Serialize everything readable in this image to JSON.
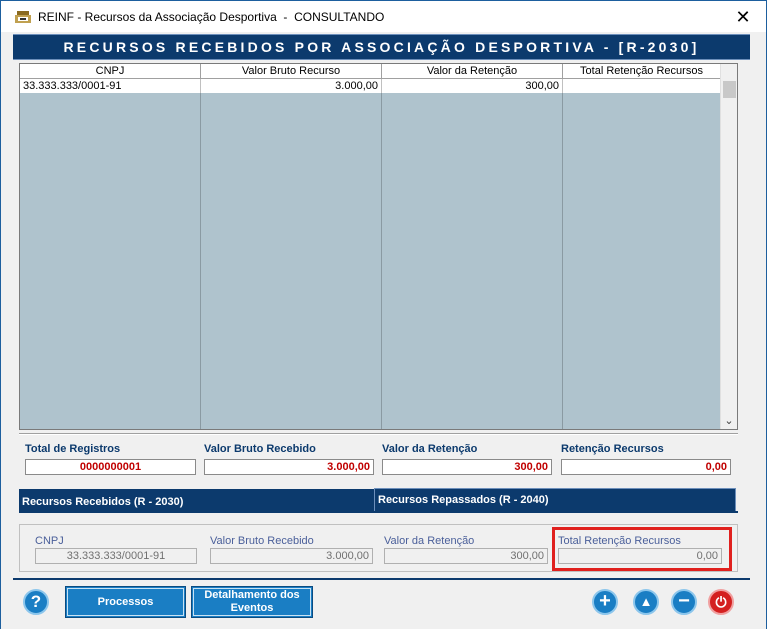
{
  "window": {
    "title": "REINF - Recursos da Associação Desportiva  -  CONSULTANDO",
    "close_label": "✕"
  },
  "header": {
    "title": "RECURSOS RECEBIDOS POR ASSOCIAÇÃO DESPORTIVA - [R-2030]"
  },
  "grid": {
    "columns": [
      "CNPJ",
      "Valor Bruto Recurso",
      "Valor da Retenção",
      "Total Retenção Recursos"
    ],
    "rows": [
      [
        "33.333.333/0001-91",
        "3.000,00",
        "300,00",
        ""
      ]
    ]
  },
  "totals": {
    "labels": [
      "Total de Registros",
      "Valor Bruto Recebido",
      "Valor da Retenção",
      "Retenção Recursos"
    ],
    "values": [
      "0000000001",
      "3.000,00",
      "300,00",
      "0,00"
    ]
  },
  "tabs": {
    "received": "Recursos Recebidos (R - 2030)",
    "transferred": "Recursos Repassados (R - 2040)"
  },
  "detail": {
    "labels": [
      "CNPJ",
      "Valor Bruto Recebido",
      "Valor da Retenção",
      "Total Retenção Recursos"
    ],
    "values": [
      "33.333.333/0001-91",
      "3.000,00",
      "300,00",
      "0,00"
    ]
  },
  "footer": {
    "help_label": "?",
    "processos_label": "Processos",
    "detalhamento_label": "Detalhamento dos Eventos",
    "add_label": "+",
    "up_label": "▲",
    "remove_label": "−",
    "power_label": "⏻"
  },
  "colors": {
    "header_bg": "#0c3a6d",
    "grid_bg": "#afc3cd",
    "total_value": "#c00000",
    "highlight": "#e0201e",
    "button_blue": "#1a7ec4",
    "button_red": "#d42020"
  }
}
